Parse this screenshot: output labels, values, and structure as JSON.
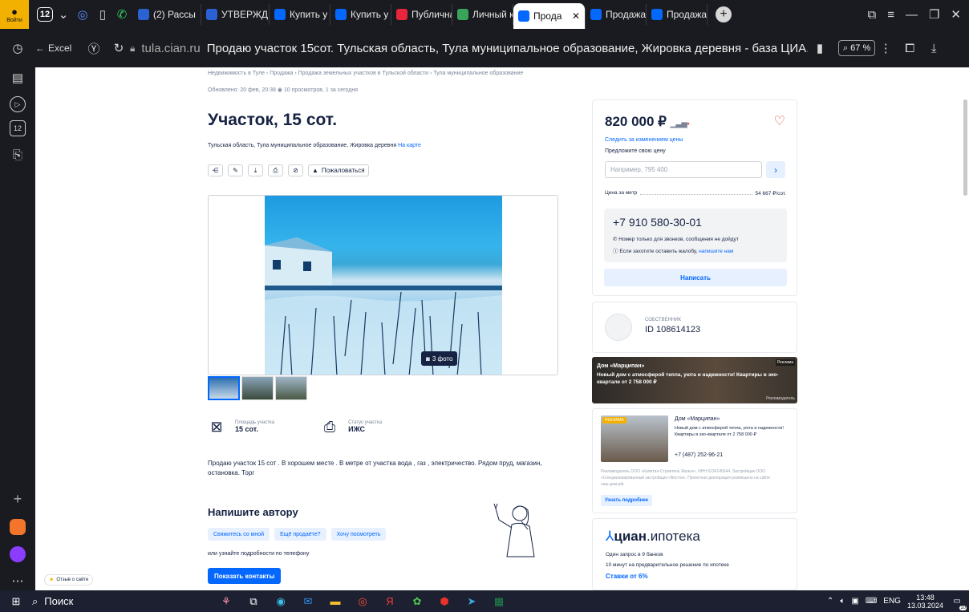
{
  "tabs": {
    "counter": "12",
    "items": [
      {
        "label": "(2) Рассы",
        "color": "#2a62d4"
      },
      {
        "label": "УТВЕРЖД",
        "color": "#2a62d4"
      },
      {
        "label": "Купить у",
        "color": "#0468ff"
      },
      {
        "label": "Купить у",
        "color": "#0468ff"
      },
      {
        "label": "Публична",
        "color": "#e8253a"
      },
      {
        "label": "Личный к",
        "color": "#3aa35a"
      }
    ],
    "active": "Прода",
    "after": [
      {
        "label": "Продажа",
        "color": "#0468ff"
      },
      {
        "label": "Продажа",
        "color": "#0468ff"
      }
    ],
    "login_label": "Войти"
  },
  "address": {
    "back_label": "Excel",
    "domain": "tula.cian.ru",
    "title": "Продаю участок 15сот. Тульская область, Тула муниципальное образование, Жировка деревня - база ЦИА...",
    "zoom": "67 %"
  },
  "page": {
    "breadcrumbs": "Недвижимость в Туле  ›  Продажа  ›  Продажа земельных участков в Тульской области  ›  Тула муниципальное образование",
    "updated": "Обновлено: 20 фев, 20:38   ◉ 10 просмотров, 1 за сегодня",
    "title": "Участок, 15 сот.",
    "address": "Тульская область, Тула муниципальное образование, Жировка деревня",
    "map_link": "На карте",
    "complain": "Пожаловаться",
    "photo_count": "3 фото",
    "facts": [
      {
        "label": "Площадь участка",
        "value": "15 сот."
      },
      {
        "label": "Статус участка",
        "value": "ИЖС"
      }
    ],
    "description": "Продаю участок 15 сот . В хорошем месте . В метре от участка вода , газ , электричество. Рядом пруд, магазин, остановка. Торг",
    "write_title": "Напишите автору",
    "chips": [
      "Свяжитесь со мной",
      "Ещё продаёте?",
      "Хочу посмотреть"
    ],
    "phone_note": "или узнайте подробности по телефону",
    "contacts_btn": "Показать контакты",
    "feedback": "Отзыв о сайте"
  },
  "price_card": {
    "price": "820 000 ₽",
    "follow": "Следить за изменением цены",
    "propose": "Предложите свою цену",
    "propose_placeholder": "Например, 795 400",
    "ppm_label": "Цена за метр",
    "ppm_value": "54 667 ₽/сот.",
    "phone": "+7 910 580-30-01",
    "note1": "Номер только для звонков, сообщения не дойдут",
    "note2": "Если захотите оставить жалобу,",
    "note2_link": "напишите нам",
    "write_btn": "Написать"
  },
  "owner": {
    "role": "собственник",
    "id": "ID 108614123"
  },
  "ad1": {
    "tag": "Реклама",
    "title": "Дом «Марципан»",
    "text": "Новый дом с атмосферой тепла, уюта и надежности! Квартиры в эко-квартале от 2 758 000 ₽",
    "domain": "Рекламодатель"
  },
  "ad2": {
    "badge": "РЕКЛАМА",
    "title": "Дом «Марципан»",
    "text": "Новый дом с атмосферой тепла, уюта и надежности! Квартиры в эко-квартале от 2 758 000 ₽",
    "phone": "+7 (487) 252-96-21",
    "legal": "Рекламодатель ООО «Капитал-Строитель Жилья», ИНН 6234145644. Застройщик ООО «Специализированный застройщик «Восток». Проектная декларация размещена на сайте наш.дом.рф.",
    "more": "Узнать подробнее"
  },
  "mortgage": {
    "logo_bold": "циан",
    "logo_rest": ".ипотека",
    "line1": "Один запрос в 9 банков",
    "line2": "10 минут на предварительное решение по ипотеке",
    "line3": "Ставки от 6%"
  },
  "taskbar": {
    "search": "Поиск",
    "lang": "ENG",
    "time": "13:48",
    "date": "13.03.2024",
    "notif": "10"
  },
  "colors": {
    "accent": "#0468ff",
    "text": "#152242",
    "heart": "#e8473c"
  }
}
